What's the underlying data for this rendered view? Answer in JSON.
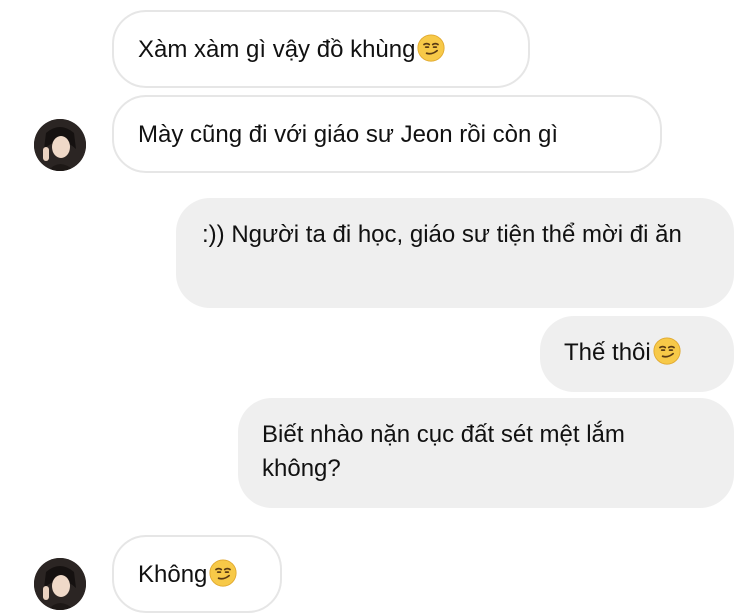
{
  "messages": [
    {
      "direction": "incoming",
      "text": "Xàm xàm gì vậy đồ khùng",
      "emoji": "smirk"
    },
    {
      "direction": "incoming",
      "text": "Mày cũng đi với giáo sư Jeon rồi còn gì",
      "emoji": ""
    },
    {
      "direction": "outgoing",
      "text": ":)) Người ta đi học, giáo sư tiện thể mời đi ăn",
      "emoji": ""
    },
    {
      "direction": "outgoing",
      "text": "Thế thôi",
      "emoji": "smirk"
    },
    {
      "direction": "outgoing",
      "text": "Biết nhào nặn cục đất sét mệt lắm không?",
      "emoji": ""
    },
    {
      "direction": "incoming",
      "text": "Không",
      "emoji": "smirk"
    }
  ],
  "colors": {
    "incoming_bg": "#ffffff",
    "incoming_border": "#e6e6e6",
    "outgoing_bg": "#efefef",
    "text": "#111111"
  },
  "icons": {
    "avatar": "contact-avatar",
    "emoji": "smirking-face-icon"
  }
}
